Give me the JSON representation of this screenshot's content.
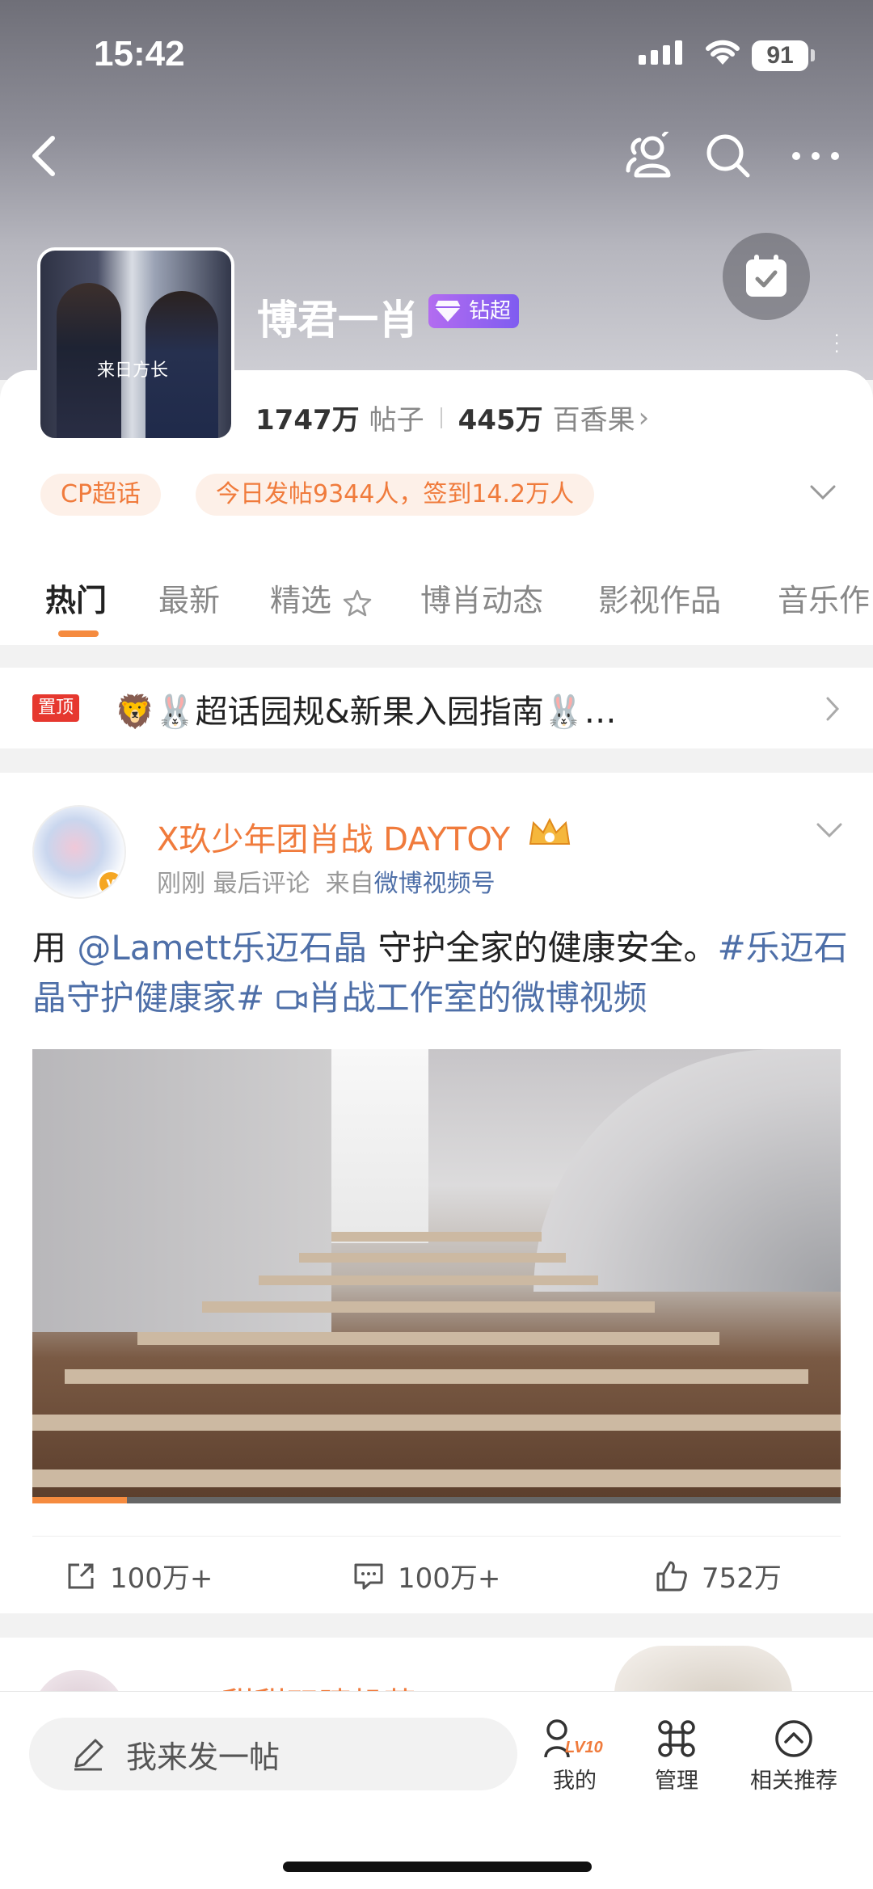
{
  "status": {
    "time": "15:42",
    "battery": "91"
  },
  "header": {
    "title": "博君一肖",
    "badge": "钻超",
    "avatar_caption": "来日方长",
    "stats": {
      "posts_num": "1747万",
      "posts_label": "帖子",
      "fans_num": "445万",
      "fans_label": "百香果",
      "chevron": "›"
    }
  },
  "chips": {
    "tag": "CP超话",
    "summary": "今日发帖9344人，签到14.2万人"
  },
  "tabs": [
    {
      "label": "热门"
    },
    {
      "label": "最新"
    },
    {
      "label": "精选"
    },
    {
      "label": "博肖动态"
    },
    {
      "label": "影视作品"
    },
    {
      "label": "音乐作"
    }
  ],
  "pinned": {
    "tag": "置顶",
    "text": "🦁🐰超话园规&新果入园指南🐰…"
  },
  "post": {
    "author": "X玖少年团肖战 DAYTOY",
    "verified": "v",
    "time": "刚刚",
    "last_comment": "最后评论",
    "source_prefix": "来自",
    "source": "微博视频号",
    "text_pre": "用 ",
    "mention": "@Lamett乐迈石晶",
    "text_mid": " 守护全家的健康安全。",
    "hashtag": "#乐迈石晶守护健康家#",
    "video_link": "肖战工作室的微博视频",
    "progress": 0.117,
    "share": "100万+",
    "comments": "100万+",
    "likes": "752万"
  },
  "post2": {
    "author": "LAN甜甜双睫机芽"
  },
  "bottom": {
    "compose_placeholder": "我来发一帖",
    "my": "我的",
    "level": "LV10",
    "manage": "管理",
    "related": "相关推荐"
  },
  "colors": {
    "accent": "#f58b3f",
    "link": "#4e6fa8",
    "chip_text": "#f07b3c",
    "pin_red": "#e6382f"
  }
}
